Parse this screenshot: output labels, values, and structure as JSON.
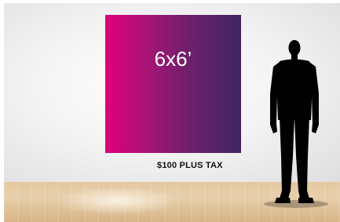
{
  "banner": {
    "size_label": "6x6’",
    "gradient_start": "#e1007a",
    "gradient_end": "#3f2560"
  },
  "price": {
    "label": "$100 PLUS TAX"
  },
  "figure": {
    "icon": "person-silhouette-icon",
    "color": "#000000"
  }
}
